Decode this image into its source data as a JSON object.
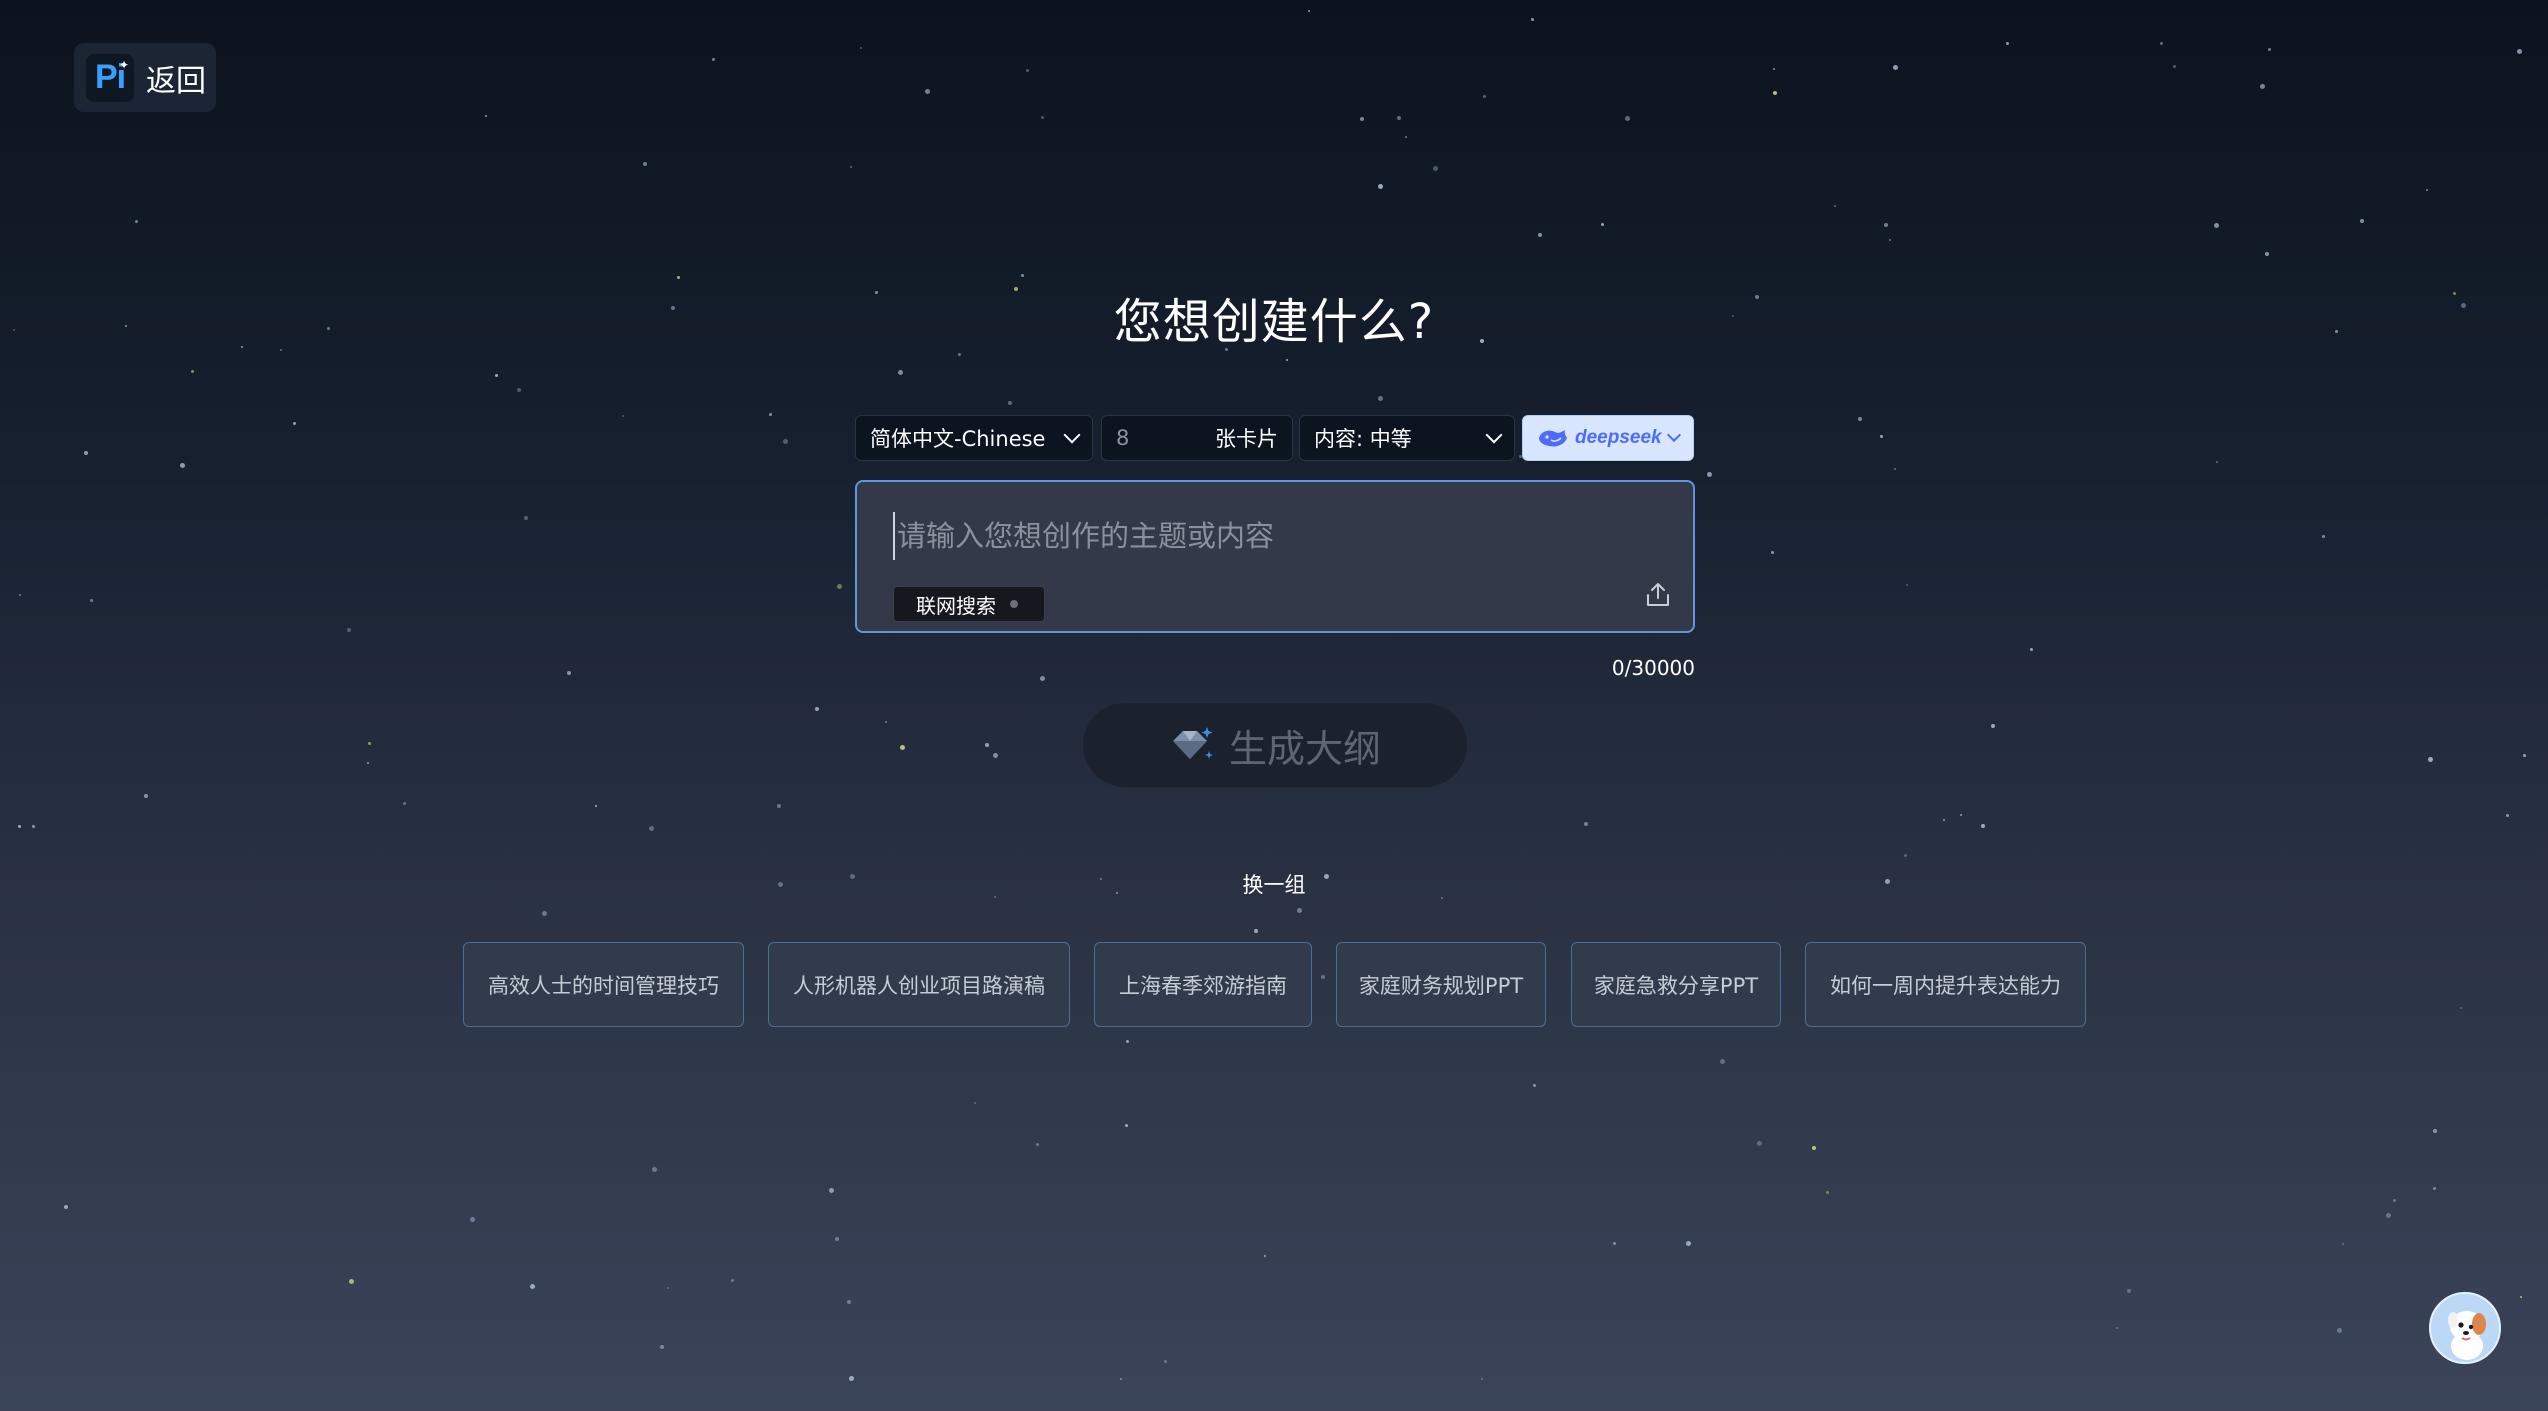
{
  "header": {
    "back_label": "返回",
    "logo_text": "Pi"
  },
  "main": {
    "title": "您想创建什么?",
    "options": {
      "language": "简体中文-Chinese",
      "card_count": "8",
      "card_unit": "张卡片",
      "content_level": "内容: 中等",
      "model": "deepseek"
    },
    "input": {
      "placeholder": "请输入您想创作的主题或内容",
      "value": "",
      "web_search_label": "联网搜索",
      "counter": "0/30000"
    },
    "generate_label": "生成大纲",
    "refresh_label": "换一组",
    "suggestions": [
      "高效人士的时间管理技巧",
      "人形机器人创业项目路演稿",
      "上海春季郊游指南",
      "家庭财务规划PPT",
      "家庭急救分享PPT",
      "如何一周内提升表达能力"
    ]
  },
  "colors": {
    "accent": "#4d6bfe",
    "input_border": "#5f98d9",
    "logo_blue": "#3aa0ff"
  },
  "icons": {
    "upload": "upload-icon",
    "generate": "sparkle-diamond-icon",
    "mascot": "dog-mascot-icon",
    "model": "deepseek-whale-icon"
  }
}
